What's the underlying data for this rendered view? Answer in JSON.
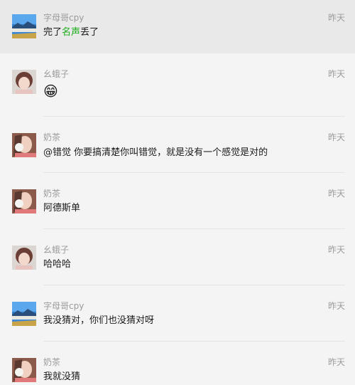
{
  "messages": [
    {
      "sender": "字母哥cpy",
      "time": "昨天",
      "text_before": "完了",
      "highlight": "名声",
      "text_after": "丢了",
      "avatar": "landscape"
    },
    {
      "sender": "幺蛾子",
      "time": "昨天",
      "emoji": "😁",
      "avatar": "short-hair-girl"
    },
    {
      "sender": "奶茶",
      "time": "昨天",
      "text": "@错觉 你要搞清楚你叫错觉，就是没有一个感觉是对的",
      "avatar": "flower-girl"
    },
    {
      "sender": "奶茶",
      "time": "昨天",
      "text": "阿德斯单",
      "avatar": "flower-girl"
    },
    {
      "sender": "幺蛾子",
      "time": "昨天",
      "text": "哈哈哈",
      "avatar": "short-hair-girl"
    },
    {
      "sender": "字母哥cpy",
      "time": "昨天",
      "text": "我没猜对，你们也没猜对呀",
      "avatar": "landscape"
    },
    {
      "sender": "奶茶",
      "time": "昨天",
      "text": "我就没猜",
      "avatar": "flower-girl"
    }
  ],
  "colors": {
    "background": "#f4f4f4",
    "highlight_row": "#e9e9e9",
    "name_text": "#9b9b9b",
    "body_text": "#1a1a1a",
    "mention_green": "#1aad19"
  }
}
